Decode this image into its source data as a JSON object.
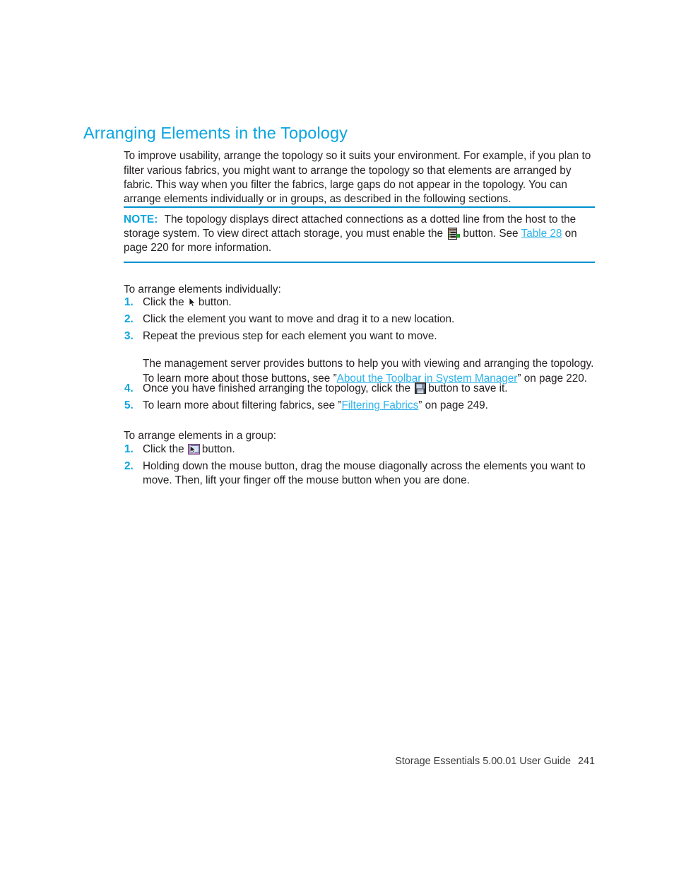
{
  "document": {
    "heading": "Arranging Elements in the Topology",
    "intro_paragraph": "To improve usability, arrange the topology so it suits your environment. For example, if you plan to filter various fabrics, you might want to arrange the topology so that elements are arranged by fabric. This way when you filter the fabrics, large gaps do not appear in the topology. You can arrange elements individually or in groups, as described in the following sections."
  },
  "note": {
    "label": "NOTE:",
    "text_part1": "The topology displays direct attached connections as a dotted line from the host to the storage system. To view direct attach storage, you must enable the",
    "icon_name": "storage-array-icon",
    "text_part2": "button. See",
    "link": "Table 28",
    "text_part3": "on page 220 for more information."
  },
  "individually": {
    "lead_in": "To arrange elements individually:",
    "steps": [
      {
        "number": "1.",
        "text_before": "Click the",
        "icon_name": "cursor-arrow-icon",
        "text_after": "button."
      },
      {
        "number": "2.",
        "text": "Click the element you want to move and drag it to a new location."
      },
      {
        "number": "3.",
        "text": "Repeat the previous step for each element you want to move."
      },
      {
        "number": "4.",
        "text_before": "Once you have finished arranging the topology, click the",
        "icon_name": "save-floppy-icon",
        "text_after": "button to save it."
      },
      {
        "number": "5.",
        "text_before": "To learn more about filtering fabrics, see ”",
        "link": "Filtering Fabrics",
        "text_after": "” on page 249."
      }
    ],
    "substep": {
      "text_before": "The management server provides buttons to help you with viewing and arranging the topology. To learn more about those buttons, see ”",
      "link": "About the Toolbar in System Manager",
      "text_after": "” on page 220."
    }
  },
  "group": {
    "lead_in": "To arrange elements in a group:",
    "steps": [
      {
        "number": "1.",
        "text_before": "Click the",
        "icon_name": "group-select-icon",
        "text_after": "button."
      },
      {
        "number": "2.",
        "text": "Holding down the mouse button, drag the mouse diagonally across the elements you want to move. Then, lift your finger off the mouse button when you are done."
      }
    ]
  },
  "footer": {
    "guide": "Storage Essentials 5.00.01 User Guide",
    "page_number": "241"
  },
  "colors": {
    "accent": "#0ba5e0",
    "link": "#2fb3ea",
    "rule": "#0090d0",
    "body_text": "#231f20"
  }
}
